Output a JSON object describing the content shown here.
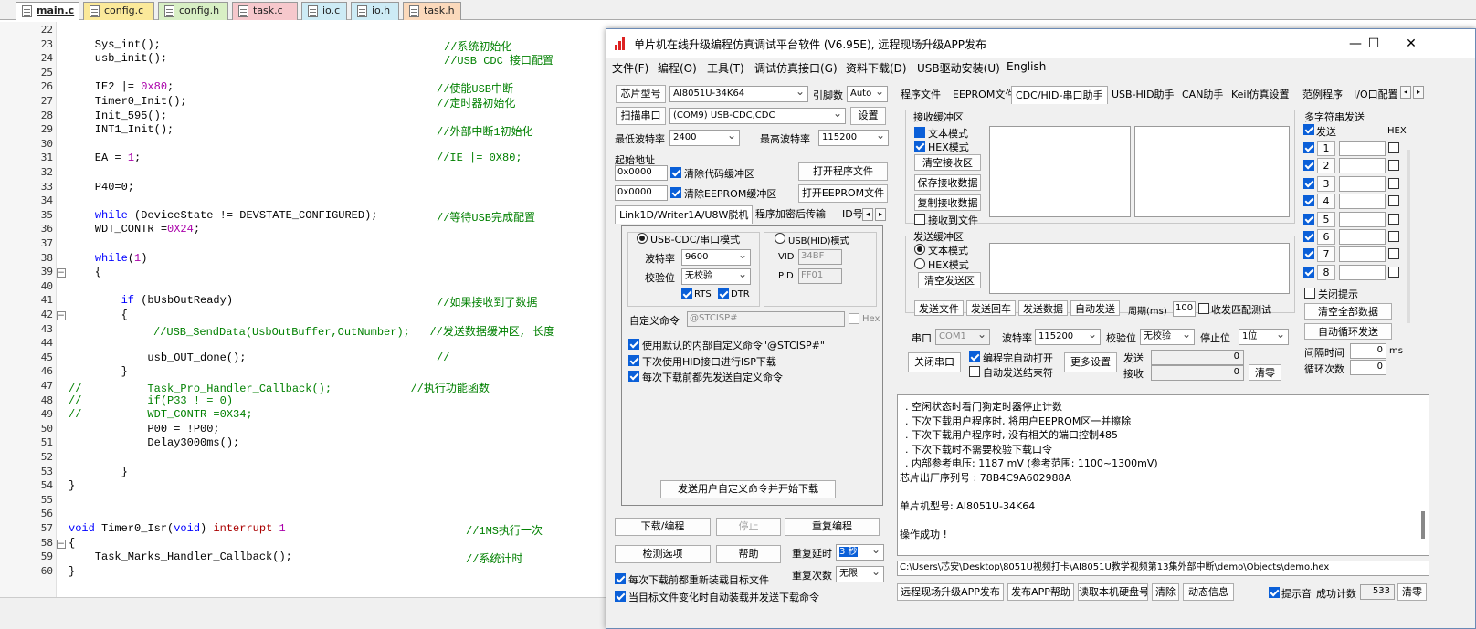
{
  "editor": {
    "tabs": [
      {
        "label": "main.c",
        "color": "#ffffff"
      },
      {
        "label": "config.c",
        "color": "#fbe99a"
      },
      {
        "label": "config.h",
        "color": "#d8efc4"
      },
      {
        "label": "task.c",
        "color": "#f6c8cc"
      },
      {
        "label": "io.c",
        "color": "#cdebf5"
      },
      {
        "label": "io.h",
        "color": "#cdebf5"
      },
      {
        "label": "task.h",
        "color": "#fbd9bb"
      }
    ],
    "lines": [
      {
        "n": "22",
        "code": "",
        "comment": ""
      },
      {
        "n": "23",
        "code": "    Sys_int();",
        "comment": "//系统初始化"
      },
      {
        "n": "24",
        "code": "    usb_init();",
        "comment": "//USB CDC 接口配置"
      },
      {
        "n": "25",
        "code": "",
        "comment": ""
      },
      {
        "n": "26",
        "code": "    IE2 |= 0x80;",
        "comment": "//使能USB中断"
      },
      {
        "n": "27",
        "code": "    Timer0_Init();",
        "comment": "//定时器初始化"
      },
      {
        "n": "28",
        "code": "    Init_595();",
        "comment": ""
      },
      {
        "n": "29",
        "code": "    INT1_Init();",
        "comment": "//外部中断1初始化"
      },
      {
        "n": "30",
        "code": "",
        "comment": ""
      },
      {
        "n": "31",
        "code": "    EA = 1;",
        "comment": "//IE |= 0X80;"
      },
      {
        "n": "32",
        "code": "",
        "comment": ""
      },
      {
        "n": "33",
        "code": "    P40=0;",
        "comment": ""
      },
      {
        "n": "34",
        "code": "",
        "comment": ""
      },
      {
        "n": "35",
        "code": "    while (DeviceState != DEVSTATE_CONFIGURED);",
        "comment": "//等待USB完成配置"
      },
      {
        "n": "36",
        "code": "    WDT_CONTR =0X24;",
        "comment": ""
      },
      {
        "n": "37",
        "code": "",
        "comment": ""
      },
      {
        "n": "38",
        "code": "    while(1)",
        "comment": ""
      },
      {
        "n": "39",
        "code": "    {",
        "comment": ""
      },
      {
        "n": "40",
        "code": "",
        "comment": ""
      },
      {
        "n": "41",
        "code": "        if (bUsbOutReady)",
        "comment": "//如果接收到了数据"
      },
      {
        "n": "42",
        "code": "        {",
        "comment": ""
      },
      {
        "n": "43",
        "code": "",
        "comment": "//USB_SendData(UsbOutBuffer,OutNumber);   //发送数据缓冲区, 长度"
      },
      {
        "n": "44",
        "code": "",
        "comment": ""
      },
      {
        "n": "45",
        "code": "            usb_OUT_done();",
        "comment": "//"
      },
      {
        "n": "46",
        "code": "        }",
        "comment": ""
      },
      {
        "n": "47",
        "code": "",
        "comment": "//          Task_Pro_Handler_Callback();            //执行功能函数"
      },
      {
        "n": "48",
        "code": "",
        "comment": "//          if(P33 ! = 0)"
      },
      {
        "n": "49",
        "code": "",
        "comment": "//          WDT_CONTR =0X34;"
      },
      {
        "n": "50",
        "code": "            P00 = !P00;",
        "comment": ""
      },
      {
        "n": "51",
        "code": "            Delay3000ms();",
        "comment": ""
      },
      {
        "n": "52",
        "code": "",
        "comment": ""
      },
      {
        "n": "53",
        "code": "        }",
        "comment": ""
      },
      {
        "n": "54",
        "code": "}",
        "comment": ""
      },
      {
        "n": "55",
        "code": "",
        "comment": ""
      },
      {
        "n": "56",
        "code": "",
        "comment": ""
      },
      {
        "n": "57",
        "code": "void Timer0_Isr(void) interrupt 1",
        "comment": "//1MS执行一次"
      },
      {
        "n": "58",
        "code": "{",
        "comment": ""
      },
      {
        "n": "59",
        "code": "    Task_Marks_Handler_Callback();",
        "comment": "//系统计时"
      },
      {
        "n": "60",
        "code": "}",
        "comment": ""
      }
    ]
  },
  "isp": {
    "title": "单片机在线升级编程仿真调试平台软件 (V6.95E), 远程现场升级APP发布",
    "menu": [
      "文件(F)",
      "编程(O)",
      "工具(T)",
      "调试仿真接口(G)",
      "资料下载(D)",
      "USB驱动安装(U)",
      "English"
    ],
    "chip_label": "芯片型号",
    "chip_value": "AI8051U-34K64",
    "pin_label": "引脚数",
    "pin_value": "Auto",
    "scan_label": "扫描串口",
    "port_value": "(COM9) USB-CDC,CDC",
    "settings_label": "设置",
    "min_baud_label": "最低波特率",
    "min_baud": "2400",
    "max_baud_label": "最高波特率",
    "max_baud": "115200",
    "start_addr_label": "起始地址",
    "addr1": "0x0000",
    "clear_code_label": "清除代码缓冲区",
    "open_prog_label": "打开程序文件",
    "addr2": "0x0000",
    "clear_eeprom_label": "清除EEPROM缓冲区",
    "open_eeprom_label": "打开EEPROM文件",
    "subtabs": [
      "Link1D/Writer1A/U8W脱机",
      "程序加密后传输",
      "ID号"
    ],
    "usb_cdc_label": "USB-CDC/串口模式",
    "usb_hid_label": "USB(HID)模式",
    "baud_label": "波特率",
    "baud_value": "9600",
    "parity_label": "校验位",
    "parity_value": "无校验",
    "rts": "RTS",
    "dtr": "DTR",
    "vid_label": "VID",
    "vid": "34BF",
    "pid_label": "PID",
    "pid": "FF01",
    "custom_cmd_label": "自定义命令",
    "custom_cmd_value": "@STCISP#",
    "hex_label": "Hex",
    "opt1": "使用默认的内部自定义命令\"@STCISP#\"",
    "opt2": "下次使用HID接口进行ISP下载",
    "opt3": "每次下载前都先发送自定义命令",
    "send_custom_label": "发送用户自定义命令并开始下载",
    "download_label": "下载/编程",
    "stop_label": "停止",
    "reprogram_label": "重复编程",
    "check_label": "检测选项",
    "help_label": "帮助",
    "repeat_delay_label": "重复延时",
    "repeat_delay_value": "3 秒",
    "repeat_count_label": "重复次数",
    "repeat_count_value": "无限",
    "reload_label": "每次下载前都重新装载目标文件",
    "autoload_label": "当目标文件变化时自动装载并发送下载命令",
    "right_tabs": [
      "程序文件",
      "EEPROM文件",
      "CDC/HID-串口助手",
      "USB-HID助手",
      "CAN助手",
      "Keil仿真设置",
      "范例程序",
      "I/O口配置"
    ],
    "rx_group": "接收缓冲区",
    "rx_text": "文本模式",
    "rx_hex": "HEX模式",
    "clear_rx": "清空接收区",
    "save_rx": "保存接收数据",
    "copy_rx": "复制接收数据",
    "rx_to_file": "接收到文件",
    "tx_group": "发送缓冲区",
    "tx_text": "文本模式",
    "tx_hex": "HEX模式",
    "clear_tx": "清空发送区",
    "send_file": "发送文件",
    "send_return": "发送回车",
    "send_data": "发送数据",
    "auto_send": "自动发送",
    "period_label": "周期(ms)",
    "period_value": "100",
    "match_test": "收发匹配测试",
    "port_label": "串口",
    "port2_value": "COM1",
    "baud2_label": "波特率",
    "baud2_value": "115200",
    "parity2_label": "校验位",
    "parity2_value": "无校验",
    "stop_bits_label": "停止位",
    "stop_bits_value": "1位",
    "close_port": "关闭串口",
    "auto_open": "编程完自动打开",
    "auto_stop": "自动发送结束符",
    "more_settings": "更多设置",
    "send_count_label": "发送",
    "send_count": "0",
    "recv_count_label": "接收",
    "recv_count": "0",
    "clear_count": "清零",
    "multi_title": "多字符串发送",
    "multi_send": "发送",
    "multi_hex": "HEX",
    "multi_rows": [
      "1",
      "2",
      "3",
      "4",
      "5",
      "6",
      "7",
      "8"
    ],
    "close_tip": "关闭提示",
    "clear_all": "清空全部数据",
    "auto_loop": "自动循环发送",
    "interval_label": "间隔时间",
    "interval_value": "0",
    "interval_unit": "ms",
    "loop_count_label": "循环次数",
    "loop_count": "0",
    "log": [
      ". 空闲状态时看门狗定时器停止计数",
      ". 下次下载用户程序时, 将用户EEPROM区一并擦除",
      ". 下次下载用户程序时, 没有相关的端口控制485",
      ". 下次下载时不需要校验下载口令",
      ". 内部参考电压: 1187 mV (参考范围: 1100~1300mV)",
      "芯片出厂序列号 : 78B4C9A602988A",
      "",
      "  单片机型号: AI8051U-34K64",
      "",
      "操作成功 !"
    ],
    "filepath": "C:\\Users\\芯安\\Desktop\\8051U视频打卡\\AI8051U教学视频第13集外部中断\\demo\\Objects\\demo.hex",
    "bottom_buttons": [
      "远程现场升级APP发布",
      "发布APP帮助",
      "读取本机硬盘号",
      "清除",
      "动态信息"
    ],
    "sound_label": "提示音",
    "success_label": "成功计数",
    "success_count": "533",
    "clear_zero": "清零"
  }
}
